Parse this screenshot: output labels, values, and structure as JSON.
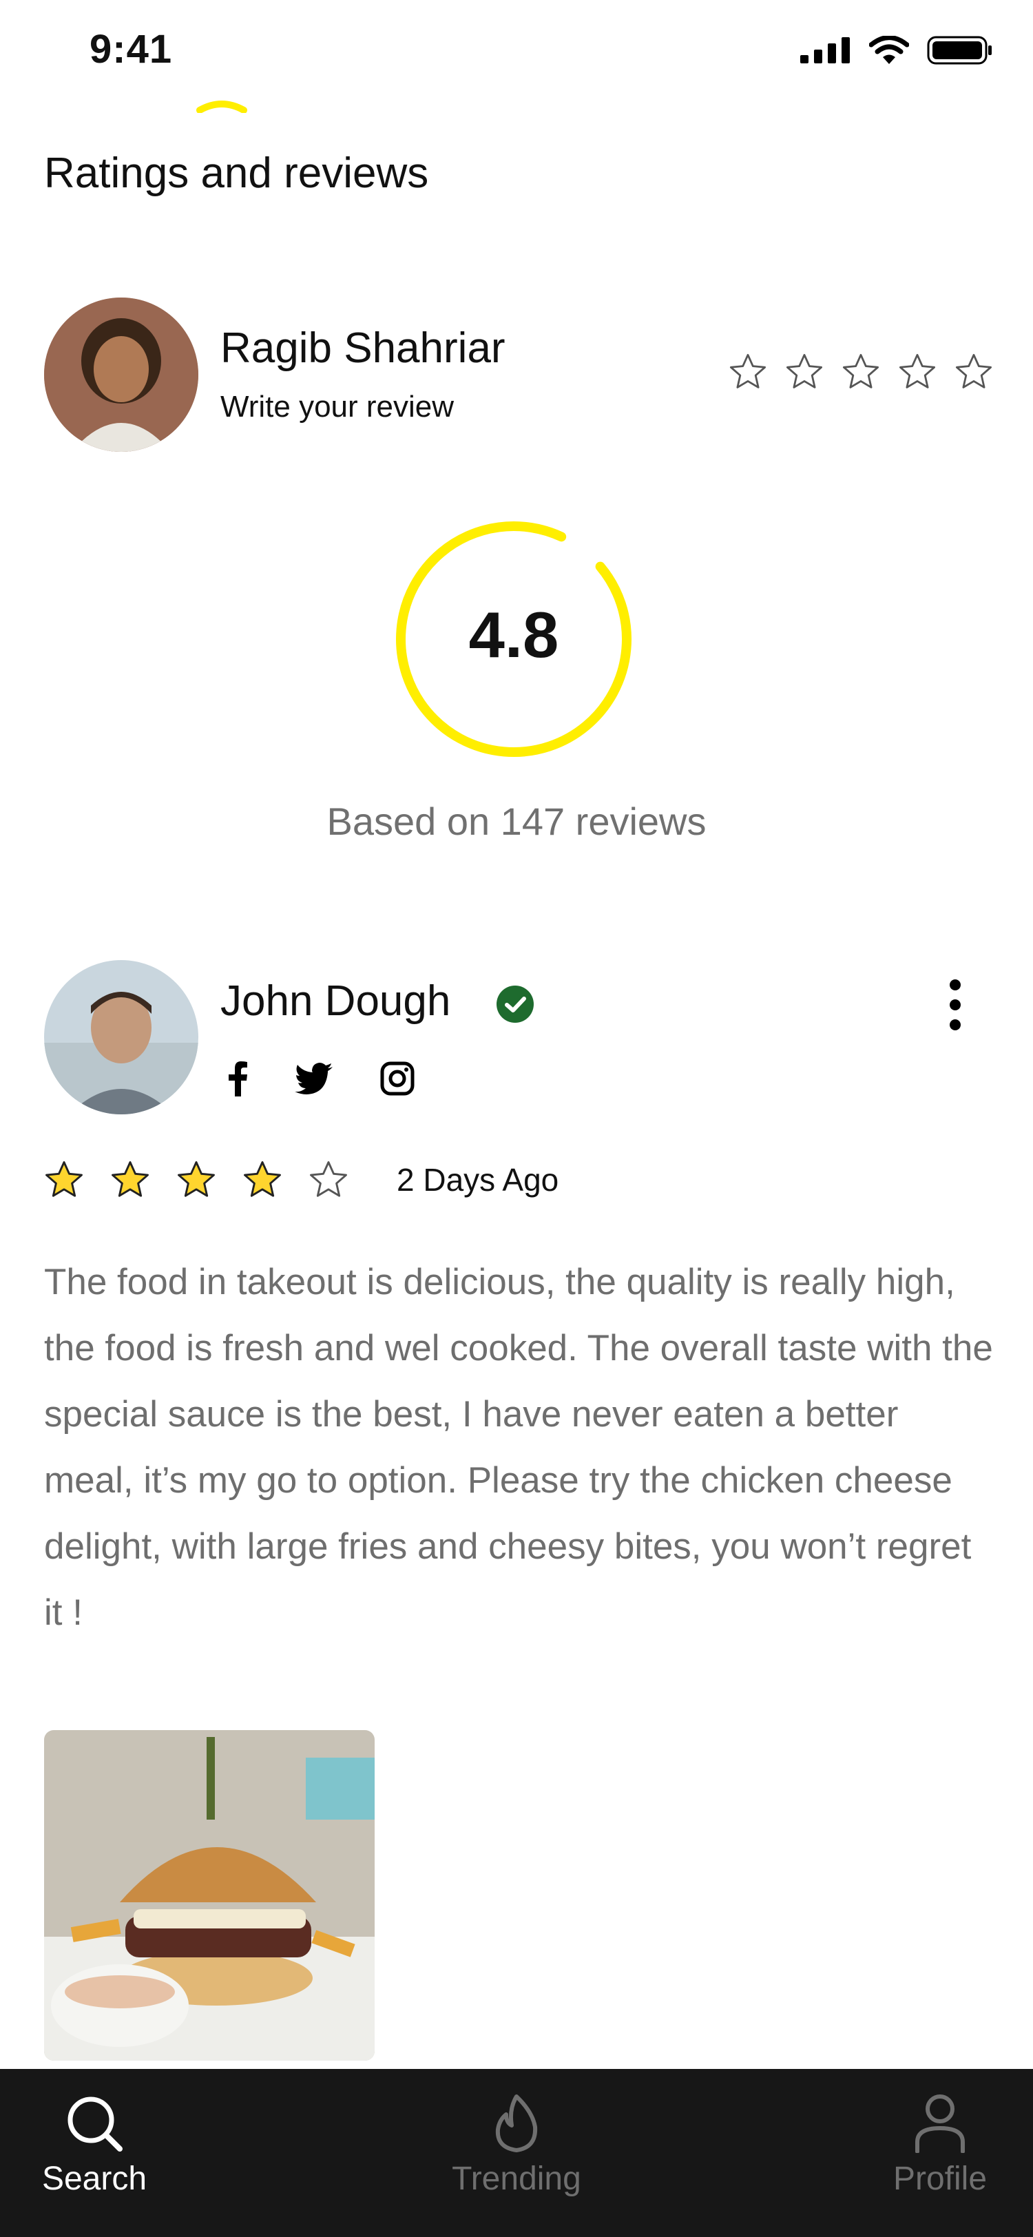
{
  "status_bar": {
    "time": "9:41"
  },
  "page": {
    "title": "Ratings and reviews"
  },
  "current_user": {
    "name": "Ragib Shahriar",
    "prompt": "Write your review",
    "rating": 0,
    "max_rating": 5
  },
  "summary": {
    "rating": "4.8",
    "caption": "Based on 147 reviews",
    "ring_fraction": 0.93,
    "accent": "#FFEE00"
  },
  "review": {
    "author": "John Dough",
    "verified": true,
    "socials": [
      "facebook-icon",
      "twitter-icon",
      "instagram-icon"
    ],
    "rating": 4,
    "max_rating": 5,
    "date": "2 Days Ago",
    "text": "The food in takeout is delicious, the quality is really high, the food is fresh and wel cooked. The overall taste with the special sauce is the best, I have never eaten a better meal, it’s my go to option. Please try the chicken cheese delight, with large fries and cheesy bites, you won’t regret it !"
  },
  "tabs": [
    {
      "label": "Search",
      "icon": "search-icon",
      "active": true
    },
    {
      "label": "Trending",
      "icon": "flame-icon",
      "active": false
    },
    {
      "label": "Profile",
      "icon": "person-icon",
      "active": false
    }
  ],
  "colors": {
    "star_fill": "#FFD52E",
    "verified": "#1E6B2E",
    "tabbar": "#171717"
  }
}
